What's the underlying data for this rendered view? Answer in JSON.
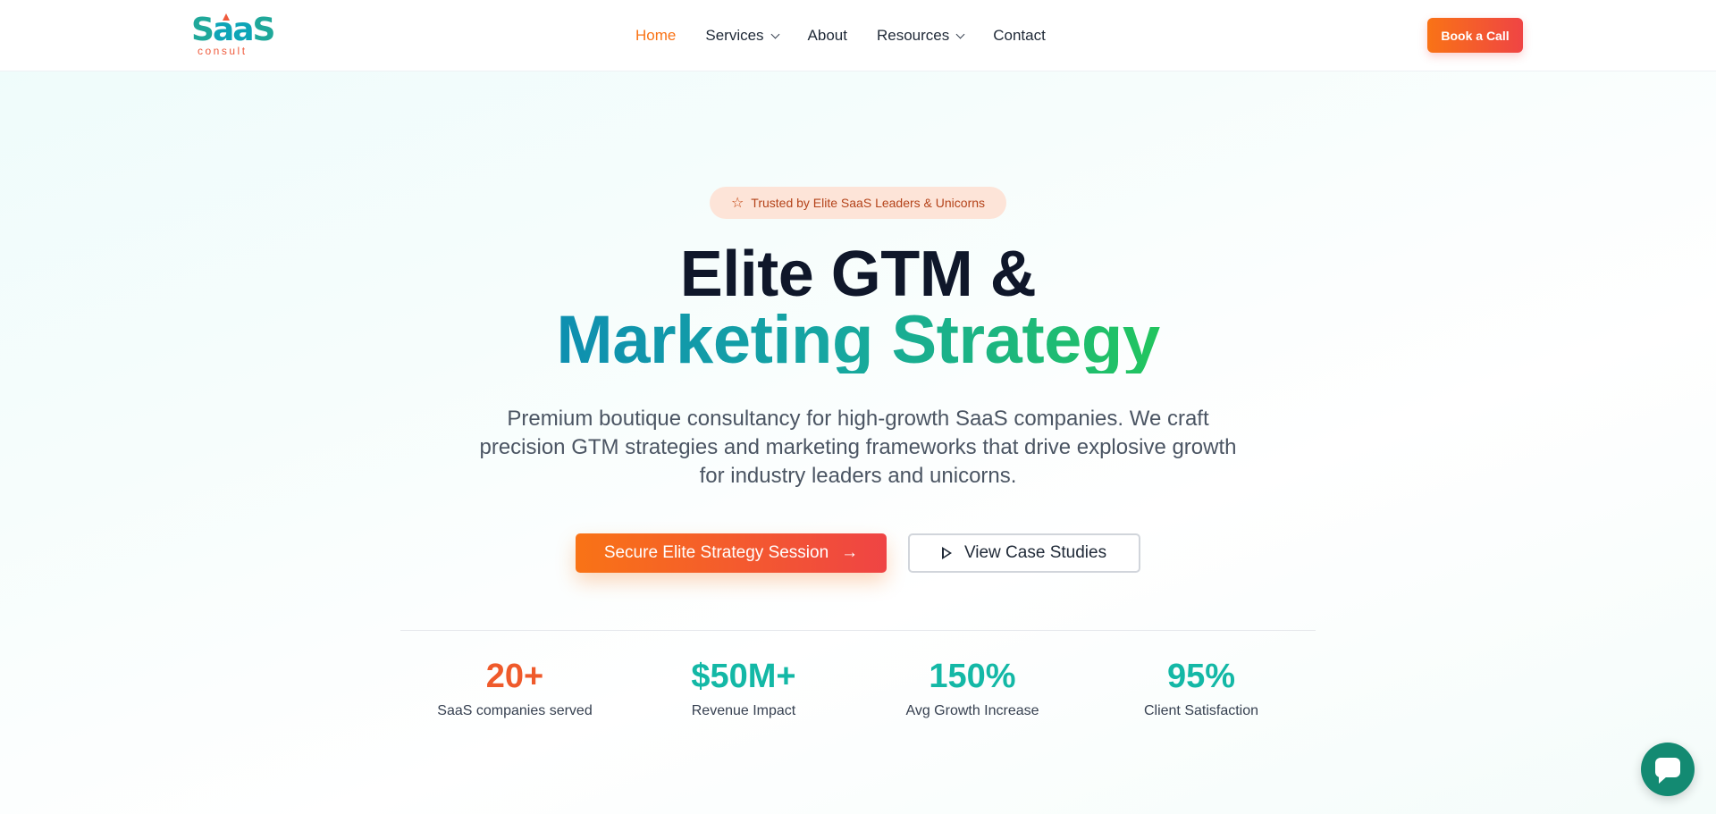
{
  "brand": {
    "logo_main_a": "S",
    "logo_main_b": "aa",
    "logo_main_c": "S",
    "logo_sub": "consult"
  },
  "nav": {
    "items": [
      {
        "label": "Home",
        "active": true,
        "dropdown": false
      },
      {
        "label": "Services",
        "active": false,
        "dropdown": true
      },
      {
        "label": "About",
        "active": false,
        "dropdown": false
      },
      {
        "label": "Resources",
        "active": false,
        "dropdown": true
      },
      {
        "label": "Contact",
        "active": false,
        "dropdown": false
      }
    ],
    "book_label": "Book a Call"
  },
  "hero": {
    "badge_icon": "star-icon",
    "badge_text": "Trusted by Elite SaaS Leaders & Unicorns",
    "headline_line1": "Elite GTM &",
    "headline_line2": "Marketing Strategy",
    "subtext": "Premium boutique consultancy for high-growth SaaS companies. We craft precision GTM strategies and marketing frameworks that drive explosive growth for industry leaders and unicorns.",
    "cta_primary": "Secure Elite Strategy Session",
    "cta_primary_icon": "arrow-right-icon",
    "cta_secondary": "View Case Studies",
    "cta_secondary_icon": "play-icon"
  },
  "stats": [
    {
      "value": "20+",
      "label": "SaaS companies served",
      "color": "#ef5a2b"
    },
    {
      "value": "$50M+",
      "label": "Revenue Impact",
      "color": "#14b8a6"
    },
    {
      "value": "150%",
      "label": "Avg Growth Increase",
      "color": "#14b8a6"
    },
    {
      "value": "95%",
      "label": "Client Satisfaction",
      "color": "#14b8a6"
    }
  ],
  "colors": {
    "accent_orange": "#f97316",
    "accent_red": "#ef4444",
    "accent_teal": "#14b8a6",
    "chat_green": "#138a72"
  },
  "chat": {
    "icon": "chat-bubble-icon"
  }
}
